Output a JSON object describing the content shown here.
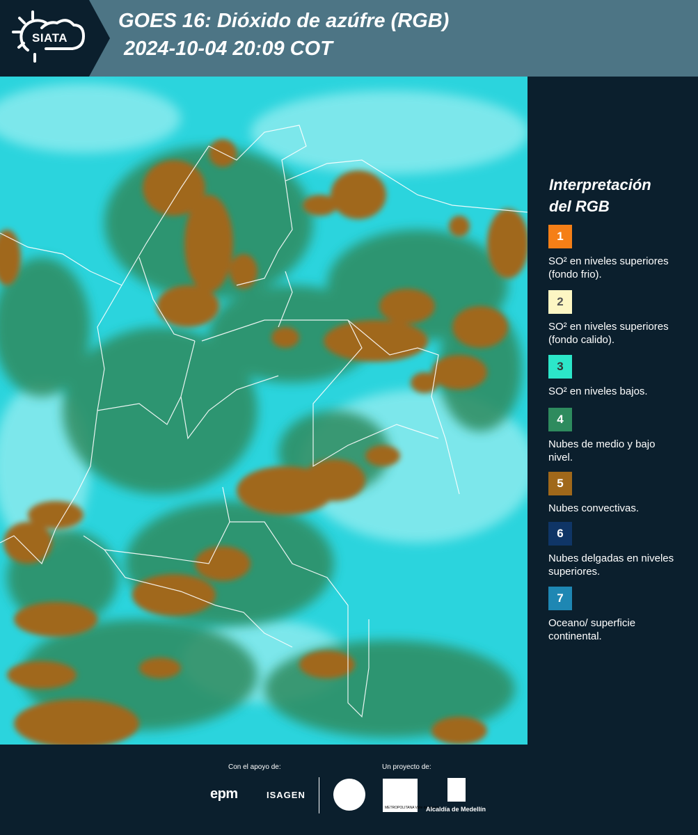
{
  "header": {
    "logo_text": "SIATA",
    "title_line1": "GOES 16: Dióxido de azúfre (RGB)",
    "title_line2": "2024-10-04 20:09 COT"
  },
  "legend": {
    "title_line1": "Interpretación",
    "title_line2": "del RGB",
    "items": [
      {
        "number": "1",
        "color": "#f57f17",
        "text_color": "#ffffff",
        "text": "SO² en niveles superiores (fondo frio)."
      },
      {
        "number": "2",
        "color": "#fdf6c3",
        "text_color": "#555555",
        "text": "SO² en niveles superiores (fondo calido)."
      },
      {
        "number": "3",
        "color": "#2ce6c9",
        "text_color": "#333333",
        "text": "SO² en niveles bajos."
      },
      {
        "number": "4",
        "color": "#2e8b5e",
        "text_color": "#ffffff",
        "text": "Nubes de medio y bajo nivel."
      },
      {
        "number": "5",
        "color": "#a0681a",
        "text_color": "#ffffff",
        "text": "Nubes convectivas."
      },
      {
        "number": "6",
        "color": "#0f3566",
        "text_color": "#ffffff",
        "text": "Nubes delgadas en niveles superiores."
      },
      {
        "number": "7",
        "color": "#1e87b3",
        "text_color": "#ffffff",
        "text": "Oceano/ superficie continental."
      }
    ]
  },
  "footer": {
    "support_label": "Con el apoyo de:",
    "project_label": "Un proyecto de:",
    "epm": "epm",
    "isagen": "ISAGEN",
    "area_text": "METROPOLITANA Valle de Aburrá",
    "alcaldia": "Alcaldía de Medellín"
  },
  "colors": {
    "header_bg": "#4d7585",
    "panel_bg": "#0b1f2d",
    "sky_cyan": "#2bd4dd",
    "cloud_brown": "#a0681a",
    "cloud_green": "#2e8b5e"
  }
}
